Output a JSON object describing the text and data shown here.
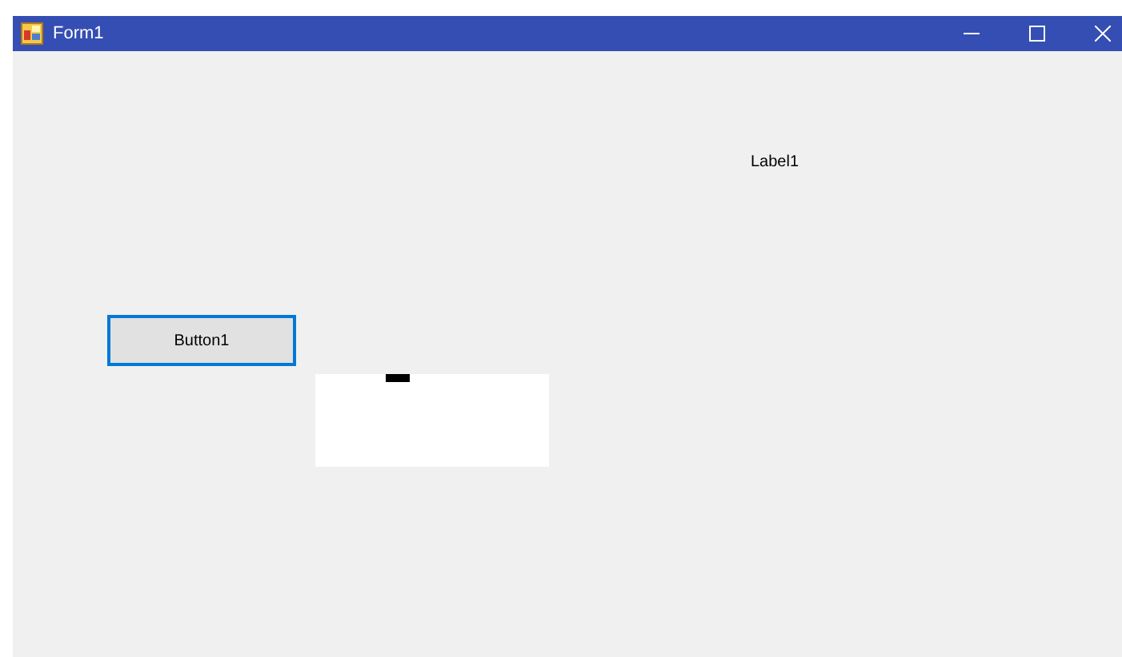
{
  "window": {
    "title": "Form1"
  },
  "controls": [
    {
      "kind": "label",
      "text": "Label1"
    },
    {
      "kind": "button",
      "text": "Button1",
      "focused": true
    },
    {
      "kind": "panel"
    }
  ]
}
